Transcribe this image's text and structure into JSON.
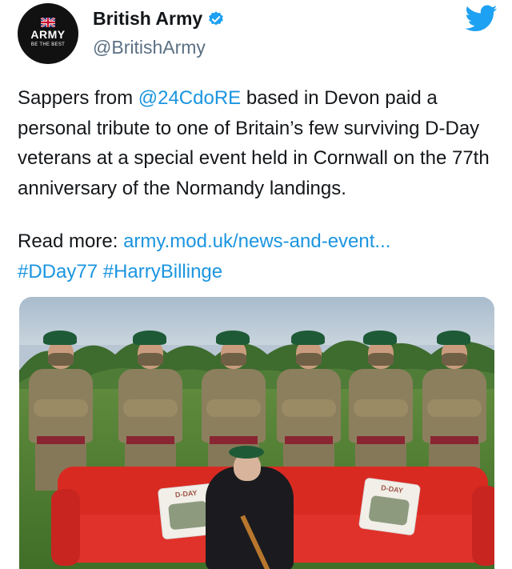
{
  "account": {
    "name": "British Army",
    "handle": "@BritishArmy",
    "avatar_title": "ARMY",
    "avatar_motto": "BE THE BEST",
    "verified_icon": "verified-badge-icon"
  },
  "tweet": {
    "text_part1": "Sappers from ",
    "mention": "@24CdoRE",
    "text_part2": " based in Devon paid a personal tribute to one of Britain’s few surviving D-Day veterans at a special event held in Cornwall on the 77th anniversary of the Normandy landings.",
    "read_more_label": "Read more: ",
    "link_text": "army.mod.uk/news-and-event...",
    "hashtag1": "#DDay77",
    "hashtag2": "#HarryBillinge"
  },
  "media": {
    "pillow_left_text": "D-DAY",
    "pillow_right_text": "D-DAY"
  },
  "colors": {
    "link": "#1b95e0",
    "twitter_blue": "#1da1f2",
    "handle_gray": "#5b7083"
  }
}
